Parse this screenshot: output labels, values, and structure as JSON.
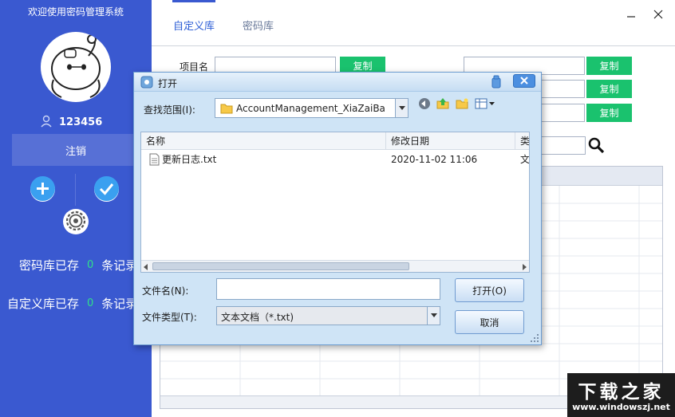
{
  "app": {
    "title": "欢迎使用密码管理系统",
    "username": "123456",
    "logout_label": "注销",
    "stats": [
      {
        "label": "密码库已存",
        "count": "0",
        "unit": "条记录"
      },
      {
        "label": "自定义库已存",
        "count": "0",
        "unit": "条记录"
      }
    ]
  },
  "main": {
    "tabs": [
      {
        "label": "自定义库",
        "active": true
      },
      {
        "label": "密码库",
        "active": false
      }
    ],
    "fields": {
      "item_name_label": "项目名",
      "copy_label": "复制"
    }
  },
  "dialog": {
    "title": "打开",
    "look_in_label": "查找范围(I):",
    "look_in_value": "AccountManagement_XiaZaiBa",
    "columns": [
      "名称",
      "修改日期",
      "类型"
    ],
    "files": [
      {
        "name": "更新日志.txt",
        "modified": "2020-11-02 11:06",
        "type": "文本文档"
      }
    ],
    "filename_label": "文件名(N):",
    "filename_value": "",
    "filetype_label": "文件类型(T):",
    "filetype_value": "文本文档（*.txt)",
    "open_button": "打开(O)",
    "cancel_button": "取消"
  },
  "watermark": {
    "big": "下载之家",
    "small": "www.windowszj.net"
  },
  "colors": {
    "sidebar": "#3a59d0",
    "accent_green": "#1ac26e",
    "count_green": "#2fe08a",
    "dialog_bg": "#cfe4f6"
  },
  "icons": {
    "avatar": "robot-avatar-icon",
    "user": "user-icon",
    "add": "plus-icon",
    "confirm": "check-icon",
    "settings": "gear-icon",
    "search": "search-icon",
    "file": "text-file-icon",
    "folder": "folder-icon"
  }
}
